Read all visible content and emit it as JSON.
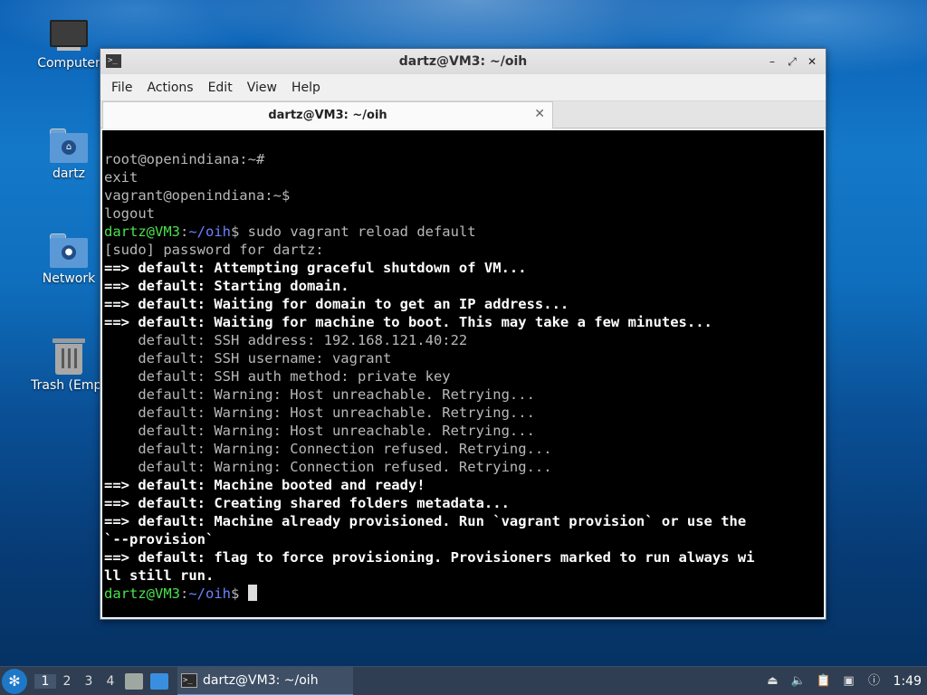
{
  "desktop": {
    "icons": [
      {
        "label": "Computer"
      },
      {
        "label": "dartz"
      },
      {
        "label": "Network"
      },
      {
        "label": "Trash (Empt"
      }
    ]
  },
  "window": {
    "title": "dartz@VM3: ~/oih",
    "menu": [
      "File",
      "Actions",
      "Edit",
      "View",
      "Help"
    ],
    "tab_title": "dartz@VM3: ~/oih",
    "controls": {
      "minimize": "–",
      "maximize": "⤢",
      "close": "✕"
    }
  },
  "terminal": {
    "lines": [
      {
        "segments": [
          {
            "text": "root@openindiana:~#",
            "style": "grey"
          }
        ]
      },
      {
        "segments": [
          {
            "text": "exit",
            "style": "grey"
          }
        ]
      },
      {
        "segments": [
          {
            "text": "vagrant@openindiana:~$",
            "style": "grey"
          }
        ]
      },
      {
        "segments": [
          {
            "text": "logout",
            "style": "grey"
          }
        ]
      },
      {
        "segments": [
          {
            "text": "dartz@VM3",
            "style": "green"
          },
          {
            "text": ":",
            "style": "grey"
          },
          {
            "text": "~/oih",
            "style": "blue"
          },
          {
            "text": "$ sudo vagrant reload default",
            "style": "grey"
          }
        ]
      },
      {
        "segments": [
          {
            "text": "[sudo] password for dartz:",
            "style": "grey"
          }
        ]
      },
      {
        "segments": [
          {
            "text": "==> default: Attempting graceful shutdown of VM...",
            "style": "white"
          }
        ]
      },
      {
        "segments": [
          {
            "text": "==> default: Starting domain.",
            "style": "white"
          }
        ]
      },
      {
        "segments": [
          {
            "text": "==> default: Waiting for domain to get an IP address...",
            "style": "white"
          }
        ]
      },
      {
        "segments": [
          {
            "text": "==> default: Waiting for machine to boot. This may take a few minutes...",
            "style": "white"
          }
        ]
      },
      {
        "segments": [
          {
            "text": "    default: SSH address: 192.168.121.40:22",
            "style": "grey"
          }
        ]
      },
      {
        "segments": [
          {
            "text": "    default: SSH username: vagrant",
            "style": "grey"
          }
        ]
      },
      {
        "segments": [
          {
            "text": "    default: SSH auth method: private key",
            "style": "grey"
          }
        ]
      },
      {
        "segments": [
          {
            "text": "    default: Warning: Host unreachable. Retrying...",
            "style": "grey"
          }
        ]
      },
      {
        "segments": [
          {
            "text": "    default: Warning: Host unreachable. Retrying...",
            "style": "grey"
          }
        ]
      },
      {
        "segments": [
          {
            "text": "    default: Warning: Host unreachable. Retrying...",
            "style": "grey"
          }
        ]
      },
      {
        "segments": [
          {
            "text": "    default: Warning: Connection refused. Retrying...",
            "style": "grey"
          }
        ]
      },
      {
        "segments": [
          {
            "text": "    default: Warning: Connection refused. Retrying...",
            "style": "grey"
          }
        ]
      },
      {
        "segments": [
          {
            "text": "==> default: Machine booted and ready!",
            "style": "white"
          }
        ]
      },
      {
        "segments": [
          {
            "text": "==> default: Creating shared folders metadata...",
            "style": "white"
          }
        ]
      },
      {
        "segments": [
          {
            "text": "==> default: Machine already provisioned. Run `vagrant provision` or use the",
            "style": "white"
          }
        ]
      },
      {
        "segments": [
          {
            "text": "`--provision`",
            "style": "white"
          }
        ]
      },
      {
        "segments": [
          {
            "text": "==> default: flag to force provisioning. Provisioners marked to run always wi",
            "style": "white"
          }
        ]
      },
      {
        "segments": [
          {
            "text": "ll still run.",
            "style": "white"
          }
        ]
      },
      {
        "segments": [
          {
            "text": "dartz@VM3",
            "style": "green"
          },
          {
            "text": ":",
            "style": "grey"
          },
          {
            "text": "~/oih",
            "style": "blue"
          },
          {
            "text": "$ ",
            "style": "grey"
          }
        ],
        "cursor": true
      }
    ]
  },
  "taskbar": {
    "workspaces": [
      "1",
      "2",
      "3",
      "4"
    ],
    "active_workspace": "1",
    "task_label": "dartz@VM3: ~/oih",
    "clock": "1:49"
  },
  "colors": {
    "prompt_user": "#4ae14a",
    "prompt_path": "#6b83ff",
    "terminal_bg": "#000000",
    "taskbar_bg": "#2f3e52",
    "accent": "#4a9ae8"
  }
}
